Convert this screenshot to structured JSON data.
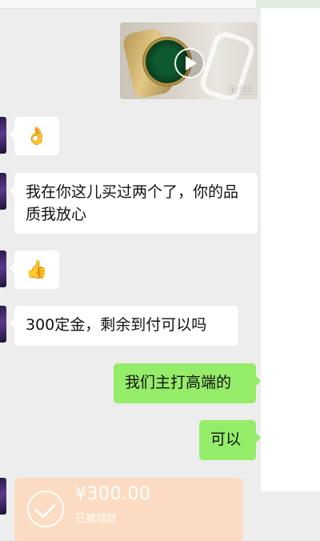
{
  "chat": {
    "video": {
      "duration": "0:15",
      "icon": "play-icon"
    },
    "messages": [
      {
        "side": "left",
        "text": "👌"
      },
      {
        "side": "left",
        "text": "我在你这儿买过两个了，你的品质我放心"
      },
      {
        "side": "left",
        "text": "👍"
      },
      {
        "side": "left",
        "text": "300定金，剩余到付可以吗"
      },
      {
        "side": "right",
        "text": "我们主打高端的"
      },
      {
        "side": "right",
        "text": "可以"
      }
    ],
    "transfer": {
      "amount": "¥300.00",
      "status": "已被领取",
      "icon": "check-circle-icon"
    }
  },
  "colors": {
    "background": "#ededed",
    "incoming_bubble": "#ffffff",
    "outgoing_bubble": "#95ec69",
    "transfer_card": "#fbdcc2"
  }
}
